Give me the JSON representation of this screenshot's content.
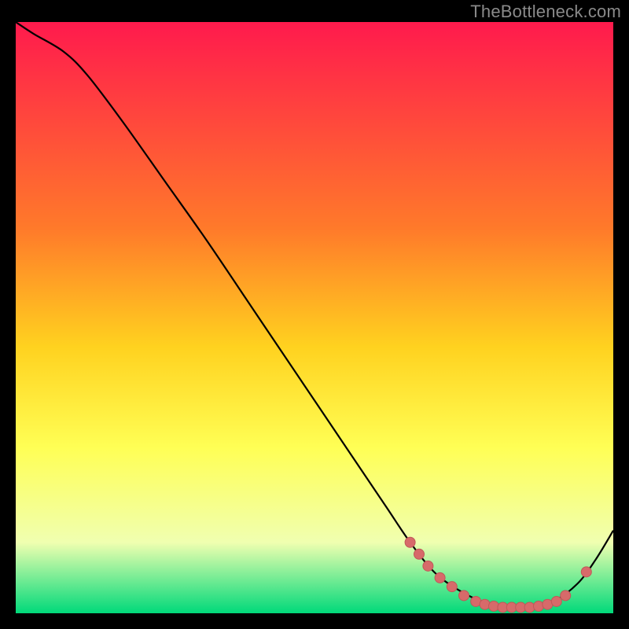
{
  "watermark": "TheBottleneck.com",
  "colors": {
    "bg": "#000000",
    "gradient_top": "#ff1a4d",
    "gradient_mid1": "#ff7a2a",
    "gradient_mid2": "#ffd21f",
    "gradient_mid3": "#ffff55",
    "gradient_mid4": "#f0ffb0",
    "gradient_bottom": "#00d97a",
    "curve": "#000000",
    "marker_fill": "#d76a6a",
    "marker_stroke": "#c05858"
  },
  "chart_data": {
    "type": "line",
    "title": "",
    "xlabel": "",
    "ylabel": "",
    "xlim": [
      0,
      100
    ],
    "ylim": [
      0,
      100
    ],
    "series": [
      {
        "name": "curve",
        "x": [
          0,
          3,
          8,
          12,
          18,
          25,
          32,
          40,
          48,
          56,
          62,
          66,
          70,
          74,
          78,
          82,
          86,
          90,
          94,
          97,
          100
        ],
        "y": [
          100,
          98,
          95,
          91,
          83,
          73,
          63,
          51,
          39,
          27,
          18,
          12,
          7,
          4,
          2,
          1,
          1,
          2,
          5,
          9,
          14
        ]
      }
    ],
    "markers": [
      {
        "x": 66,
        "y": 12
      },
      {
        "x": 67.5,
        "y": 10
      },
      {
        "x": 69,
        "y": 8
      },
      {
        "x": 71,
        "y": 6
      },
      {
        "x": 73,
        "y": 4.5
      },
      {
        "x": 75,
        "y": 3
      },
      {
        "x": 77,
        "y": 2
      },
      {
        "x": 78.5,
        "y": 1.5
      },
      {
        "x": 80,
        "y": 1.2
      },
      {
        "x": 81.5,
        "y": 1
      },
      {
        "x": 83,
        "y": 1
      },
      {
        "x": 84.5,
        "y": 1
      },
      {
        "x": 86,
        "y": 1
      },
      {
        "x": 87.5,
        "y": 1.2
      },
      {
        "x": 89,
        "y": 1.5
      },
      {
        "x": 90.5,
        "y": 2
      },
      {
        "x": 92,
        "y": 3
      },
      {
        "x": 95.5,
        "y": 7
      }
    ],
    "gradient_stops": [
      {
        "offset": 0.0,
        "color_key": "gradient_top"
      },
      {
        "offset": 0.35,
        "color_key": "gradient_mid1"
      },
      {
        "offset": 0.55,
        "color_key": "gradient_mid2"
      },
      {
        "offset": 0.72,
        "color_key": "gradient_mid3"
      },
      {
        "offset": 0.88,
        "color_key": "gradient_mid4"
      },
      {
        "offset": 1.0,
        "color_key": "gradient_bottom"
      }
    ]
  }
}
